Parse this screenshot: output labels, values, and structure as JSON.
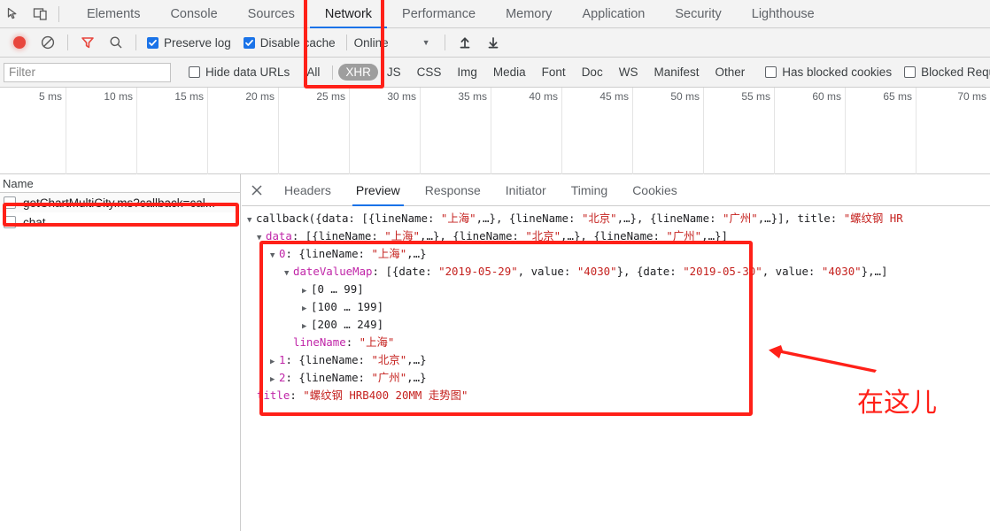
{
  "devtools": {
    "tabs": [
      {
        "label": "Elements",
        "active": false
      },
      {
        "label": "Console",
        "active": false
      },
      {
        "label": "Sources",
        "active": false
      },
      {
        "label": "Network",
        "active": true
      },
      {
        "label": "Performance",
        "active": false
      },
      {
        "label": "Memory",
        "active": false
      },
      {
        "label": "Application",
        "active": false
      },
      {
        "label": "Security",
        "active": false
      },
      {
        "label": "Lighthouse",
        "active": false
      }
    ],
    "inspect_icon": "inspect-element-icon",
    "device_icon": "device-toolbar-icon"
  },
  "toolbar": {
    "record_icon": "record-button-icon",
    "clear_icon": "clear-icon",
    "filter_icon": "filter-funnel-icon",
    "search_icon": "search-icon",
    "preserve_log_label": "Preserve log",
    "preserve_log_checked": true,
    "disable_cache_label": "Disable cache",
    "disable_cache_checked": true,
    "throttle_value": "Online",
    "caret_icon": "chevron-down-icon",
    "import_icon": "import-har-icon",
    "export_icon": "export-har-icon"
  },
  "filterbar": {
    "filter_placeholder": "Filter",
    "filter_value": "",
    "hide_data_urls_label": "Hide data URLs",
    "hide_data_urls_checked": false,
    "types": [
      {
        "label": "All",
        "selected": false
      },
      {
        "label": "XHR",
        "selected": true
      },
      {
        "label": "JS",
        "selected": false
      },
      {
        "label": "CSS",
        "selected": false
      },
      {
        "label": "Img",
        "selected": false
      },
      {
        "label": "Media",
        "selected": false
      },
      {
        "label": "Font",
        "selected": false
      },
      {
        "label": "Doc",
        "selected": false
      },
      {
        "label": "WS",
        "selected": false
      },
      {
        "label": "Manifest",
        "selected": false
      },
      {
        "label": "Other",
        "selected": false
      }
    ],
    "has_blocked_cookies_label": "Has blocked cookies",
    "has_blocked_cookies_checked": false,
    "blocked_requests_label": "Blocked Reque",
    "blocked_requests_checked": false
  },
  "overview": {
    "ticks": [
      "5 ms",
      "10 ms",
      "15 ms",
      "20 ms",
      "25 ms",
      "30 ms",
      "35 ms",
      "40 ms",
      "45 ms",
      "50 ms",
      "55 ms",
      "60 ms",
      "65 ms",
      "70 ms"
    ]
  },
  "requests": {
    "column_header": "Name",
    "rows": [
      {
        "name": "getChartMultiCity.ms?callback=cal...",
        "highlighted": true
      },
      {
        "name": "chat",
        "highlighted": false
      }
    ]
  },
  "detail": {
    "close_icon": "close-icon",
    "tabs": [
      {
        "label": "Headers",
        "active": false
      },
      {
        "label": "Preview",
        "active": true
      },
      {
        "label": "Response",
        "active": false
      },
      {
        "label": "Initiator",
        "active": false
      },
      {
        "label": "Timing",
        "active": false
      },
      {
        "label": "Cookies",
        "active": false
      }
    ]
  },
  "preview_tree": {
    "line0": {
      "prefix": "callback({data: [{lineName: ",
      "s1": "\"上海\"",
      "mid1": ",…}, {lineName: ",
      "s2": "\"北京\"",
      "mid2": ",…}, {lineName: ",
      "s3": "\"广州\"",
      "mid3": ",…}], title: ",
      "s4": "\"螺纹钢 HR"
    },
    "line1": {
      "key": "data",
      "rest_a": ": [{lineName: ",
      "s1": "\"上海\"",
      "mid_a": ",…}, {lineName: ",
      "s2": "\"北京\"",
      "mid_b": ",…}, {lineName: ",
      "s3": "\"广州\"",
      "tail": ",…}]"
    },
    "line2": {
      "key": "0",
      "rest": ": {lineName: ",
      "s1": "\"上海\"",
      "tail": ",…}"
    },
    "line3": {
      "key": "dateValueMap",
      "rest_a": ": [{date: ",
      "s1": "\"2019-05-29\"",
      "mid_a": ", value: ",
      "s2": "\"4030\"",
      "mid_b": "}, {date: ",
      "s3": "\"2019-05-30\"",
      "mid_c": ", value: ",
      "s4": "\"4030\"",
      "tail": "},…]"
    },
    "line4": {
      "text": "[0 … 99]"
    },
    "line5": {
      "text": "[100 … 199]"
    },
    "line6": {
      "text": "[200 … 249]"
    },
    "line7": {
      "key": "lineName",
      "rest": ": ",
      "s1": "\"上海\""
    },
    "line8": {
      "key": "1",
      "rest": ": {lineName: ",
      "s1": "\"北京\"",
      "tail": ",…}"
    },
    "line9": {
      "key": "2",
      "rest": ": {lineName: ",
      "s1": "\"广州\"",
      "tail": ",…}"
    },
    "line10": {
      "key": "title",
      "rest": ": ",
      "s1": "\"螺纹钢 HRB400 20MM 走势图\""
    }
  },
  "annotations": {
    "here_text": "在这儿",
    "arrow_icon": "red-arrow-pointing-left-icon",
    "box_color": "#ff2018"
  }
}
